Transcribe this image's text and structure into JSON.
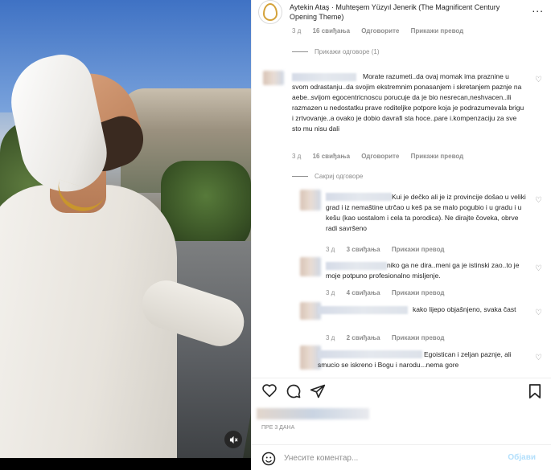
{
  "header": {
    "title": "Aytekin Ataş · Muhteşem Yüzyıl Jenerik (The Magnificent Century Opening Theme)",
    "more_label": "..."
  },
  "top_meta": {
    "time": "3 д",
    "likes": "16 свиђања",
    "reply": "Одговорите",
    "translate": "Прикажи превод"
  },
  "show_replies": "Прикажи одговоре (1)",
  "comment_main": {
    "text": "Morate razumeti..da ovaj momak ima praznine u svom odrastanju..da svojim ekstremnim ponasanjem i skretanjem paznje na aebe..svijom egocentricnoscu porucuje da je bio nesrecan,neshvacen..ili razmazen u nedostatku prave roditeljke potpore koja je podrazumevala brigu i zrtvovanje..a ovako je dobio davrafi sta hoce..pare i.kompenzaciju za sve sto mu nisu dali",
    "time": "3 д",
    "likes": "16 свиђања",
    "reply": "Одговорите",
    "translate": "Прикажи превод"
  },
  "hide_replies": "Сакриј одговоре",
  "replies": [
    {
      "text": "Kui je dečko ali je iz provincije došao u veliki grad i iz nemaštine utrčao u keš pa se malo pogubio i u gradu i u kešu (kao uostalom i cela ta porodica). Ne dirajte čoveka, obrve radi savršeno",
      "time": "3 д",
      "likes": "3 свиђања",
      "translate": "Прикажи превод"
    },
    {
      "text": "niko ga ne dira..meni ga je istinski zao..to je moje potpuno profesionalno misljenje.",
      "time": "3 д",
      "likes": "4 свиђања",
      "translate": "Прикажи превод"
    },
    {
      "text": "kako lijepo objašnjeno, svaka čast",
      "time": "3 д",
      "likes": "2 свиђања",
      "translate": "Прикажи превод"
    },
    {
      "text": "Egoistican i zeljan paznje, ali smucio se iskreno i Bogu i narodu...nema gore",
      "time": "",
      "likes": "",
      "translate": ""
    }
  ],
  "timestamp": "ПРЕ 3 ДАНА",
  "composer": {
    "placeholder": "Унесите коментар...",
    "post_label": "Објави"
  },
  "icons": {
    "heart": "heart-icon",
    "comment": "comment-icon",
    "share": "share-icon",
    "save": "bookmark-icon",
    "emoji": "emoji-icon",
    "mute": "mute-icon"
  },
  "colors": {
    "post_button": "#b2dffc",
    "secondary_text": "#8e8e8e",
    "logo_gold": "#d4a23a"
  }
}
